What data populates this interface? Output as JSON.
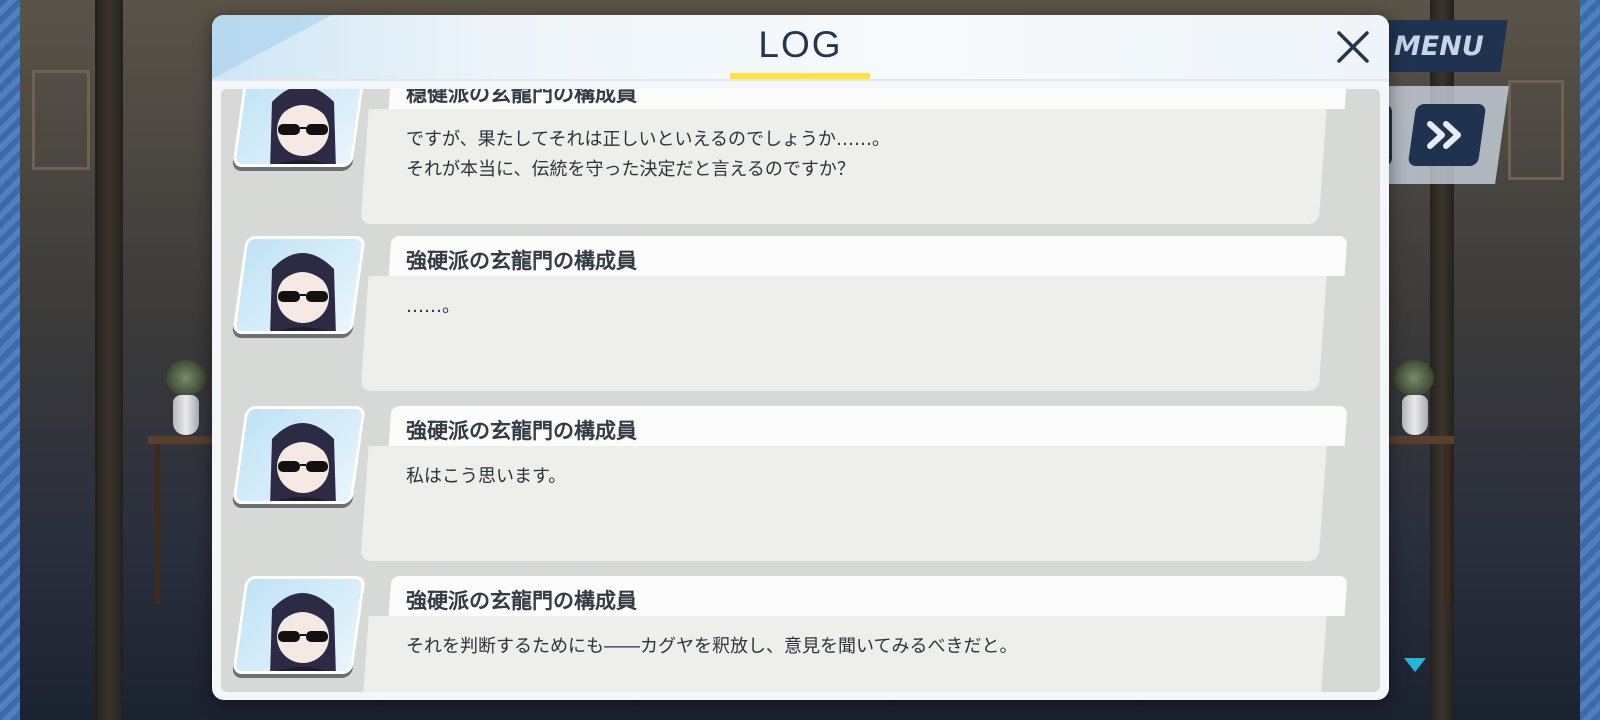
{
  "menu": {
    "label": "MENU"
  },
  "dialog": {
    "title": "LOG"
  },
  "log_entries": [
    {
      "speaker": "穏健派の玄龍門の構成員",
      "lines": [
        "ですが、果たしてそれは正しいといえるのでしょうか……。",
        "それが本当に、伝統を守った決定だと言えるのですか？"
      ]
    },
    {
      "speaker": "強硬派の玄龍門の構成員",
      "lines": [
        "……。"
      ]
    },
    {
      "speaker": "強硬派の玄龍門の構成員",
      "lines": [
        "私はこう思います。"
      ]
    },
    {
      "speaker": "強硬派の玄龍門の構成員",
      "lines": [
        "それを判断するためにも――カグヤを釈放し、意見を聞いてみるべきだと。"
      ]
    }
  ],
  "icons": {
    "close": "close-icon",
    "fast_forward": "fast-forward-icon",
    "more": "triangle-down-icon"
  },
  "colors": {
    "title_underline": "#ffe23a",
    "title_text": "#23364f",
    "menu_bg": "#1f3350",
    "more_arrow": "#27b6d6"
  }
}
